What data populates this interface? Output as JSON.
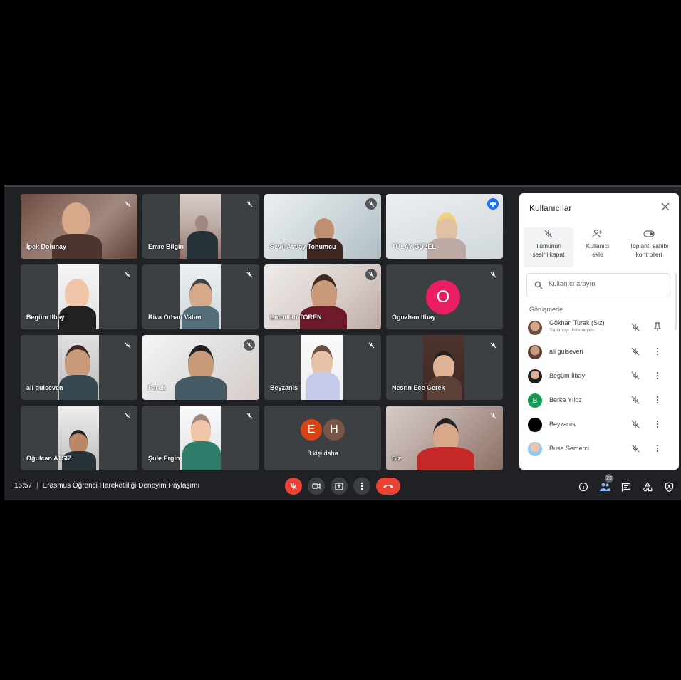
{
  "tiles": [
    {
      "name": "İpek Dolunay",
      "status": "muted"
    },
    {
      "name": "Emre Bilgin",
      "status": "muted"
    },
    {
      "name": "Sevil Atalay Tohumcu",
      "status": "muted"
    },
    {
      "name": "TÜLAY GÜZEL",
      "status": "speaking"
    },
    {
      "name": "Begüm İlbay",
      "status": "muted"
    },
    {
      "name": "Riva Orhan Vatan",
      "status": "muted"
    },
    {
      "name": "Emrullah TÖREN",
      "status": "muted"
    },
    {
      "name": "Oguzhan İlbay",
      "status": "muted",
      "avatar_letter": "O",
      "avatar_color": "#e91e63"
    },
    {
      "name": "ali gulseven",
      "status": "muted"
    },
    {
      "name": "Faruk",
      "status": "muted"
    },
    {
      "name": "Beyzanis",
      "status": "muted"
    },
    {
      "name": "Nesrin Ece Gerek",
      "status": "muted"
    },
    {
      "name": "Oğulcan ATSIZ",
      "status": "muted"
    },
    {
      "name": "Şule Ergin",
      "status": "muted"
    },
    {
      "name": "8 kişi daha",
      "status": "more",
      "avatars": [
        {
          "letter": "E",
          "color": "#d84315"
        },
        {
          "letter": "H",
          "color": "#795548"
        }
      ]
    },
    {
      "name": "Siz",
      "status": "muted"
    }
  ],
  "meeting": {
    "time": "16:57",
    "separator": "|",
    "title": "Erasmus Öğrenci Hareketliliği Deneyim Paylaşımı",
    "participant_count": "23"
  },
  "panel": {
    "title": "Kullanıcılar",
    "actions": [
      {
        "label_1": "Tümünün",
        "label_2": "sesini kapat",
        "icon": "mic-off-icon"
      },
      {
        "label_1": "Kullanıcı",
        "label_2": "ekle",
        "icon": "person-add-icon"
      },
      {
        "label_1": "Toplantı sahibi",
        "label_2": "kontrolleri",
        "icon": "toggle-icon"
      }
    ],
    "search_placeholder": "Kullanıcı arayın",
    "section_label": "Görüşmede",
    "participants": [
      {
        "name": "Gökhan Turak (Siz)",
        "sub": "Toplantıyı düzenleyen",
        "avatar": "photo"
      },
      {
        "name": "ali gulseven",
        "sub": "",
        "avatar": "photo"
      },
      {
        "name": "Begüm İlbay",
        "sub": "",
        "avatar": "photo"
      },
      {
        "name": "Berke Yıldz",
        "sub": "",
        "avatar": "letter",
        "letter": "B",
        "color": "#0f9d58"
      },
      {
        "name": "Beyzanis",
        "sub": "",
        "avatar": "letter",
        "letter": "",
        "color": "#000000"
      },
      {
        "name": "Buse Semerci",
        "sub": "",
        "avatar": "photo"
      }
    ]
  },
  "colors": {
    "accent": "#1a73e8",
    "danger": "#ea4335",
    "bg": "#202124",
    "tile": "#3c4043"
  }
}
